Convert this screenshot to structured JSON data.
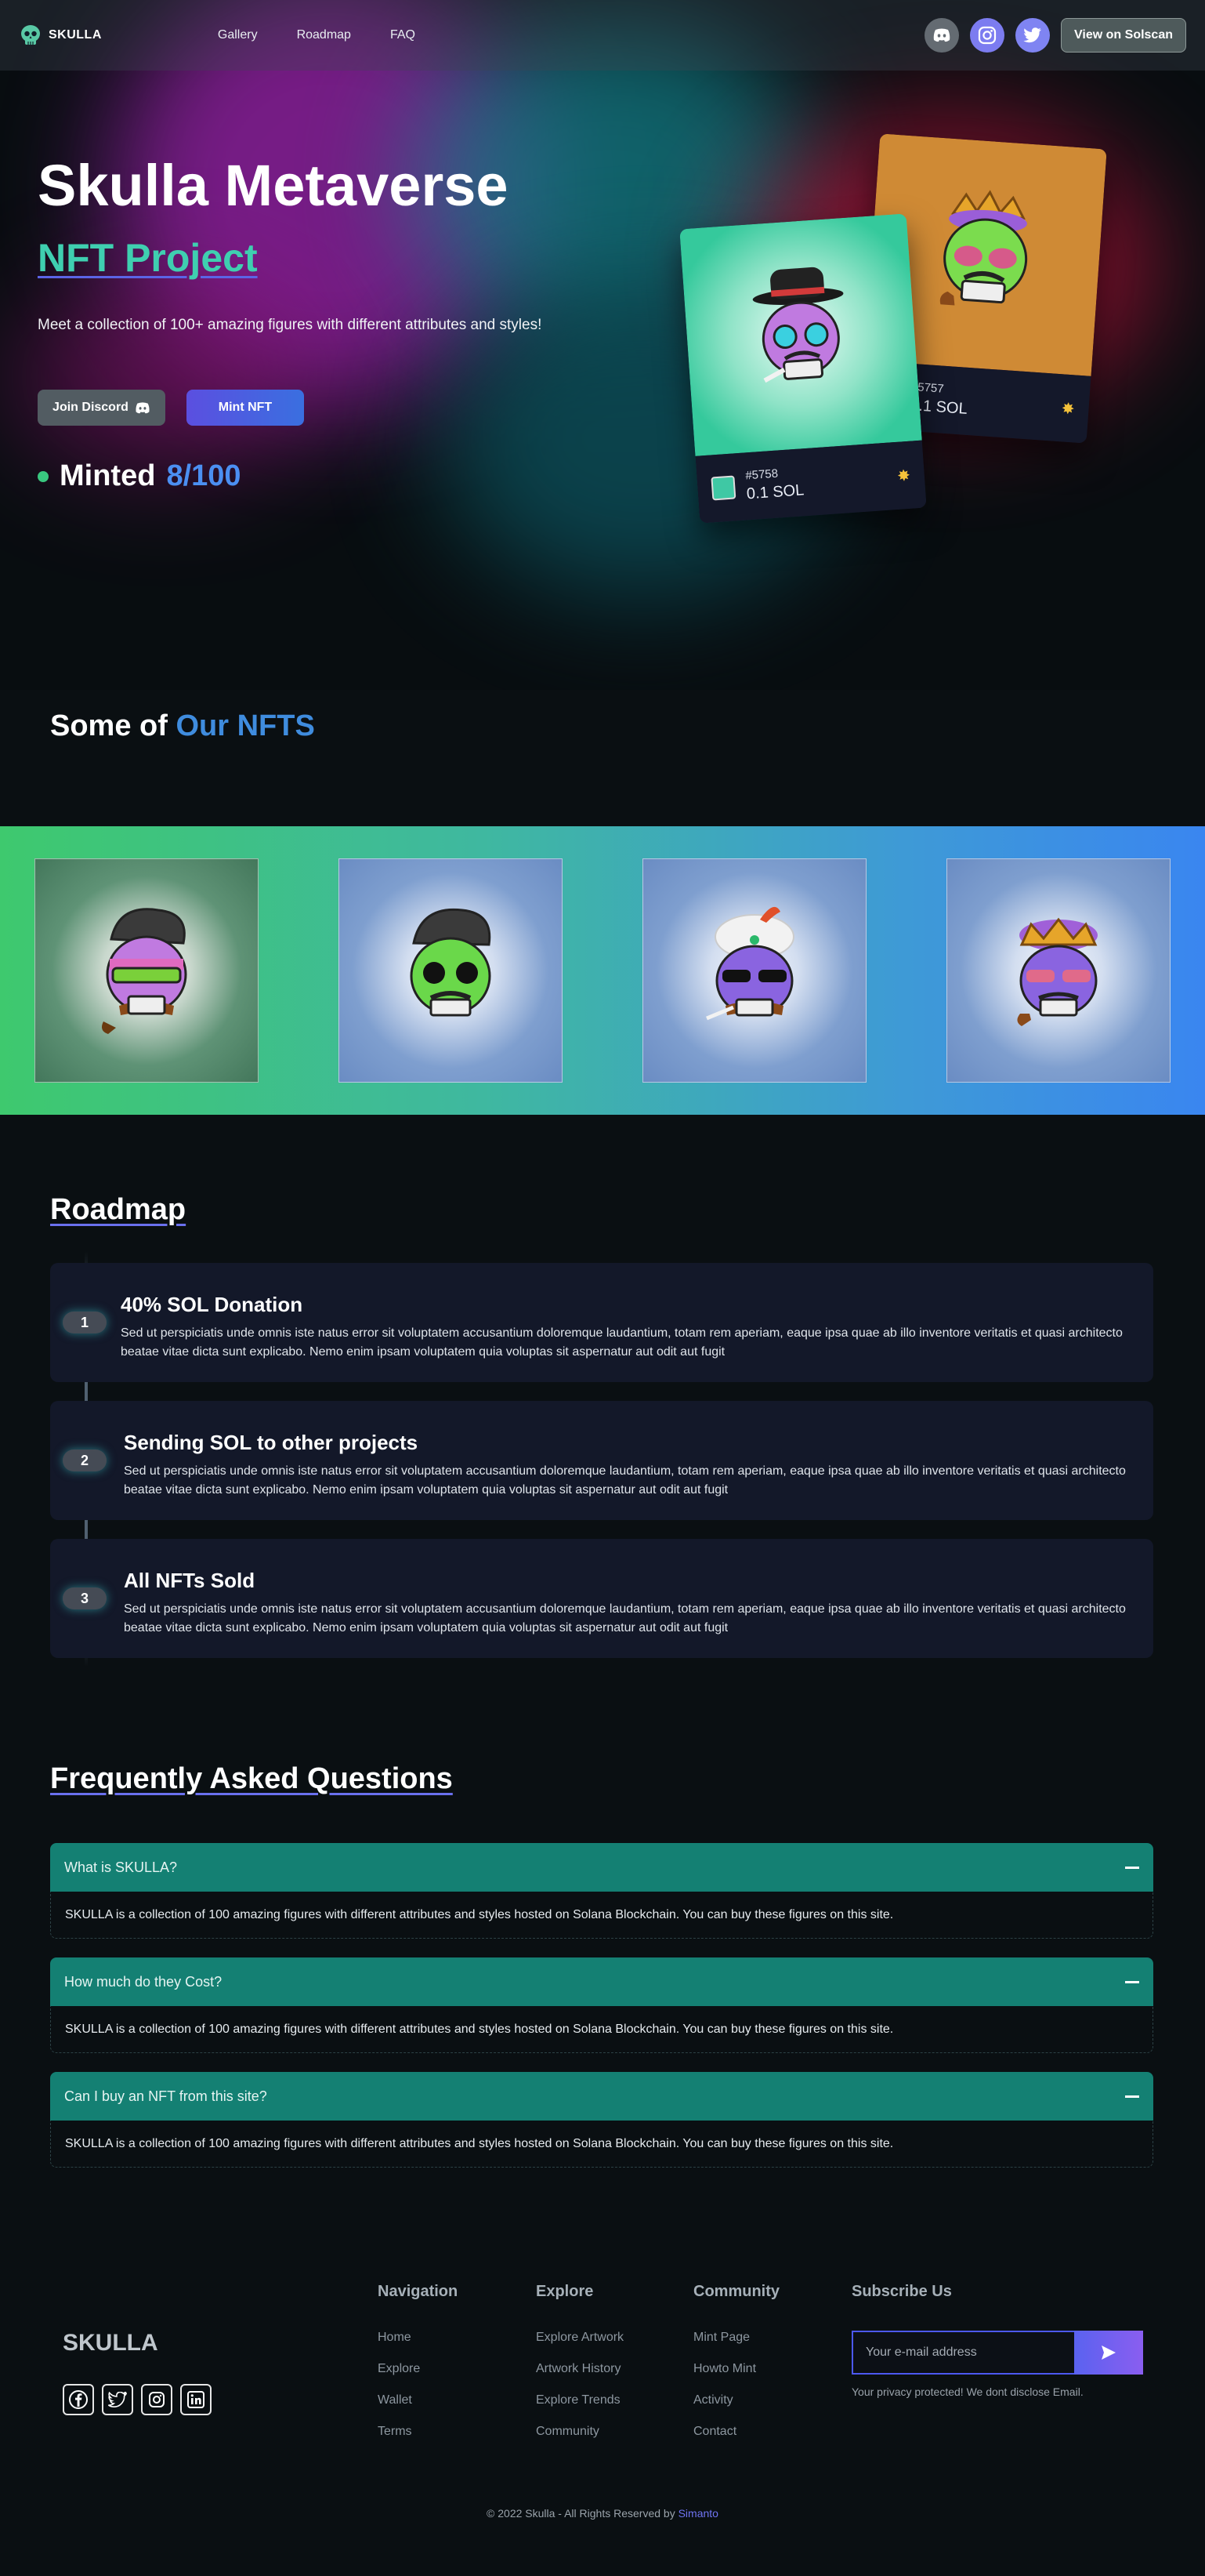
{
  "nav": {
    "brand": "SKULLA",
    "links": [
      "Gallery",
      "Roadmap",
      "FAQ"
    ],
    "cta": "View on Solscan",
    "socials": [
      "discord-icon",
      "instagram-icon",
      "twitter-icon"
    ]
  },
  "hero": {
    "title": "Skulla Metaverse",
    "subtitle": "NFT Project",
    "description": "Meet a collection of 100+ amazing figures with different attributes and styles!",
    "discord_button": "Join Discord",
    "mint_button": "Mint NFT",
    "minted_label": "Minted",
    "minted_count": "8/100",
    "cards": [
      {
        "id": "#5758",
        "price": "0.1 SOL"
      },
      {
        "id": "#5757",
        "price": "0.1 SOL"
      }
    ]
  },
  "nfts": {
    "title_prefix": "Some of",
    "title_accent": "Our NFTS"
  },
  "roadmap": {
    "title": "Roadmap",
    "items": [
      {
        "num": "1",
        "title": "40% SOL Donation",
        "text": "Sed ut perspiciatis unde omnis iste natus error sit voluptatem accusantium doloremque laudantium, totam rem aperiam, eaque ipsa quae ab illo inventore veritatis et quasi architecto beatae vitae dicta sunt explicabo. Nemo enim ipsam voluptatem quia voluptas sit aspernatur aut odit aut fugit"
      },
      {
        "num": "2",
        "title": "Sending SOL to other projects",
        "text": "Sed ut perspiciatis unde omnis iste natus error sit voluptatem accusantium doloremque laudantium, totam rem aperiam, eaque ipsa quae ab illo inventore veritatis et quasi architecto beatae vitae dicta sunt explicabo. Nemo enim ipsam voluptatem quia voluptas sit aspernatur aut odit aut fugit"
      },
      {
        "num": "3",
        "title": "All NFTs Sold",
        "text": "Sed ut perspiciatis unde omnis iste natus error sit voluptatem accusantium doloremque laudantium, totam rem aperiam, eaque ipsa quae ab illo inventore veritatis et quasi architecto beatae vitae dicta sunt explicabo. Nemo enim ipsam voluptatem quia voluptas sit aspernatur aut odit aut fugit"
      }
    ]
  },
  "faq": {
    "title": "Frequently Asked Questions",
    "items": [
      {
        "q": "What is SKULLA?",
        "a": "SKULLA is a collection of 100 amazing figures with different attributes and styles hosted on Solana Blockchain. You can buy these figures on this site."
      },
      {
        "q": "How much do they Cost?",
        "a": "SKULLA is a collection of 100 amazing figures with different attributes and styles hosted on Solana Blockchain. You can buy these figures on this site."
      },
      {
        "q": "Can I buy an NFT from this site?",
        "a": "SKULLA is a collection of 100 amazing figures with different attributes and styles hosted on Solana Blockchain. You can buy these figures on this site."
      }
    ]
  },
  "footer": {
    "brand": "SKULLA",
    "columns": [
      {
        "title": "Navigation",
        "links": [
          "Home",
          "Explore",
          "Wallet",
          "Terms"
        ]
      },
      {
        "title": "Explore",
        "links": [
          "Explore Artwork",
          "Artwork History",
          "Explore Trends",
          "Community"
        ]
      },
      {
        "title": "Community",
        "links": [
          "Mint Page",
          "Howto Mint",
          "Activity",
          "Contact"
        ]
      }
    ],
    "subscribe_title": "Subscribe Us",
    "email_placeholder": "Your e-mail address",
    "privacy": "Your privacy protected! We dont disclose Email.",
    "copyright": "© 2022 Skulla - All Rights Reserved by",
    "author": "Simanto"
  },
  "colors": {
    "accent_teal": "#3fcfb0",
    "accent_blue": "#4b8ff2",
    "faq_header": "#148073"
  }
}
